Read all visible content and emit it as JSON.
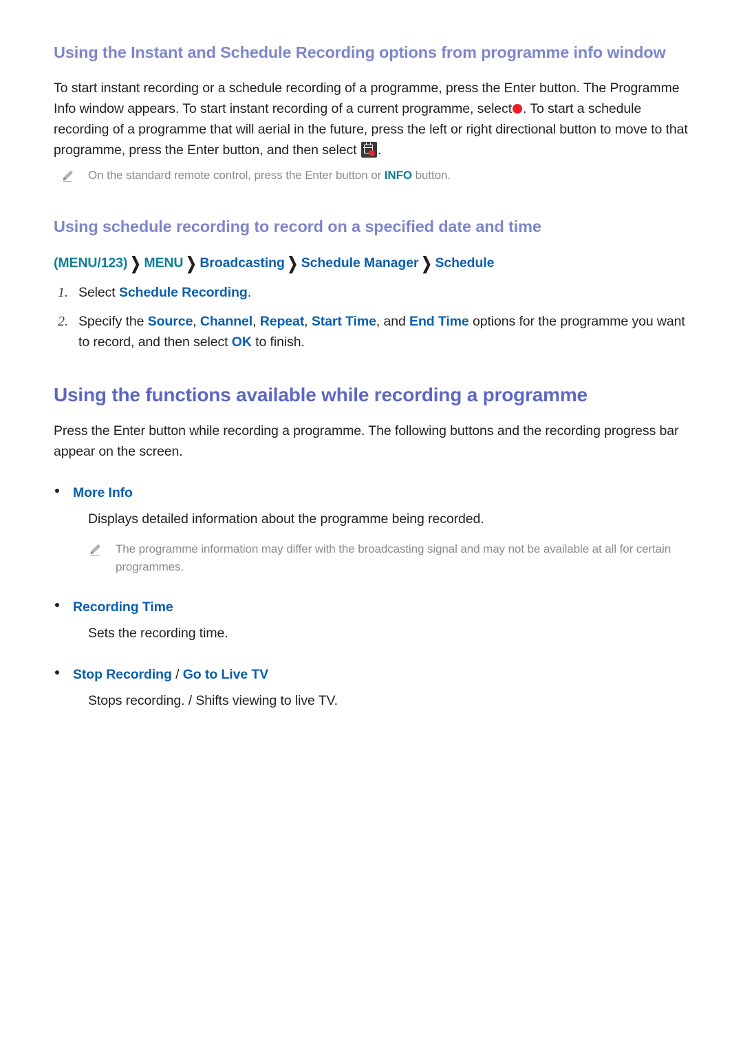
{
  "section1": {
    "heading": "Using the Instant and Schedule Recording options from programme info window",
    "para_a": "To start instant recording or a schedule recording of a programme, press the Enter button. The Programme Info window appears. To start instant recording of a current programme, select",
    "para_b": ". To start a schedule recording of a programme that will aerial in the future, press the left or right directional button to move to that programme, press the Enter button, and then select",
    "para_c": ".",
    "note": {
      "text_before": "On the standard remote control, press the Enter button or",
      "link": "INFO",
      "text_after": "button."
    }
  },
  "section2": {
    "heading": "Using schedule recording to record on a specified date and time",
    "menu_path": [
      "(MENU/123)",
      "MENU",
      "Broadcasting",
      "Schedule Manager",
      "Schedule"
    ],
    "steps": [
      {
        "num": "1.",
        "before": "Select",
        "link": "Schedule Recording",
        "after": "."
      },
      {
        "num": "2.",
        "before": "Specify the",
        "links": [
          "Source",
          "Channel",
          "Repeat",
          "Start Time",
          "End Time"
        ],
        "mid_and": ", and",
        "after": " options for the programme you want to record, and then select",
        "ok": "OK",
        "tail": "to finish."
      }
    ]
  },
  "section3": {
    "heading": "Using the functions available while recording a programme",
    "intro": "Press the Enter button while recording a programme. The following buttons and the recording progress bar appear on the screen.",
    "bullets": [
      {
        "label": "More Info",
        "description": "Displays detailed information about the programme being recorded.",
        "note": "The programme information may differ with the broadcasting signal and may not be available at all for certain programmes."
      },
      {
        "label": "Recording Time",
        "description": "Sets the recording time."
      },
      {
        "label_part1": "Stop Recording",
        "label_sep": " / ",
        "label_part2": "Go to Live TV",
        "description": "Stops recording. / Shifts viewing to live TV."
      }
    ]
  },
  "icons": {
    "record_dot": "record-dot-icon",
    "schedule_record": "schedule-record-icon",
    "note_pencil": "pencil-icon",
    "chevron": "chevron-right-icon"
  },
  "colors": {
    "heading_primary": "#5d68c2",
    "heading_secondary": "#7d86cb",
    "link_blue": "#0b5fad",
    "link_teal": "#0d7f96",
    "note_gray": "#8b8b8b",
    "record_red": "#ee1c25",
    "body_text": "#231f20"
  }
}
